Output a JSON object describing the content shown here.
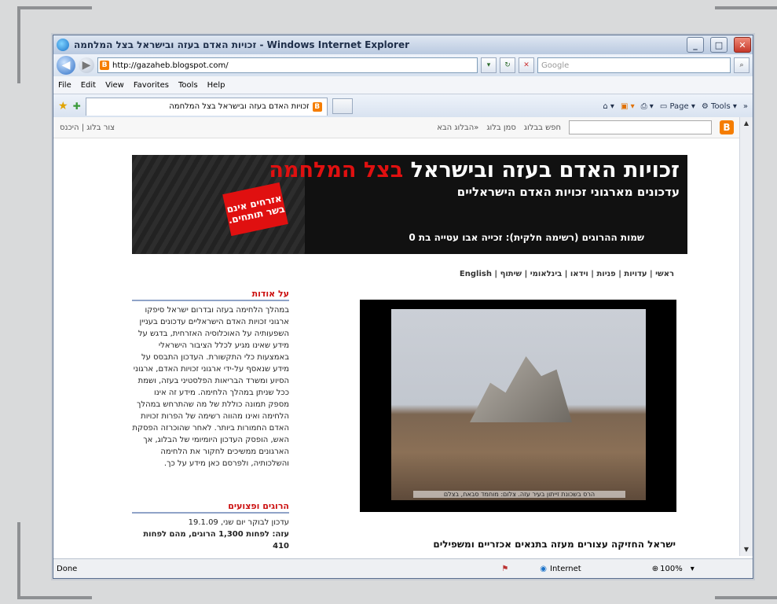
{
  "window": {
    "title": "זכויות האדם בעזה ובישראל בצל המלחמה - Windows Internet Explorer"
  },
  "address": {
    "url": "http://gazaheb.blogspot.com/",
    "search_placeholder": "Google"
  },
  "menu": [
    "File",
    "Edit",
    "View",
    "Favorites",
    "Tools",
    "Help"
  ],
  "tab": {
    "label": "זכויות האדם בעזה ובישראל בצל המלחמה"
  },
  "commands": {
    "page": "Page",
    "tools": "Tools"
  },
  "bloggerbar": {
    "create": "צור בלוג | היכנס",
    "search": "חפש בבלוג",
    "next": "הבלוג הבא»",
    "flag": "סמן בלוג"
  },
  "banner": {
    "title_white": "זכויות האדם בעזה ובישראל ",
    "title_red": "בצל המלחמה",
    "subtitle": "עדכונים מארגוני זכויות האדם הישראליים",
    "stamp": "אזרחים אינם בשר תותחים.",
    "names": "שמות ההרוגים (רשימה חלקית): זכייה אבו עטייה בת 0"
  },
  "topnav": "ראשי | עדויות | פניות | וידאו | בינלאומי | שיתוף | English",
  "photo": {
    "caption": "הרס בשכונת זייתון בעיר עזה. צלום: מוחמד סבאח, בצלם"
  },
  "headline": "ישראל החזיקה עצורים מעזה בתנאים אכזריים ומשפילים",
  "sidebar": {
    "about_title": "על אודות",
    "about_text": "במהלך הלחימה בעזה ובדרום ישראל סיפקו ארגוני זכויות האדם הישראליים עדכונים בעניין השפעותיה על האוכלוסיה האזרחית, בדגש על מידע שאינו מגיע לכלל הציבור הישראלי באמצעות כלי התקשורת. העדכון התבסס על מידע שנאסף על-ידי ארגוני זכויות האדם, ארגוני הסיוע ומשרד הבריאות הפלסטיני בעזה, ושמת ככל שניתן במהלך הלחימה. מידע זה אינו מספק תמונה כוללת של מה שהתרחש במהלך הלחימה ואינו מהווה רשימה של הפרות זכויות האדם החמורות ביותר. לאחר שהוכרזה הפסקת האש, הופסק העדכון היומיומי של הבלוג, אך הארגונים ממשיכים לחקור את הלחימה והשלכותיה, ולפרסם כאן מידע על כך.",
    "casualties_title": "הרוגים ופצועים",
    "update": "עדכון לבוקר יום שני, 19.1.09",
    "gaza": "עזה: לפחות 1,300 הרוגים, מהם לפחות 410"
  },
  "status": {
    "left": "Done",
    "zone": "Internet",
    "zoom": "100%"
  }
}
